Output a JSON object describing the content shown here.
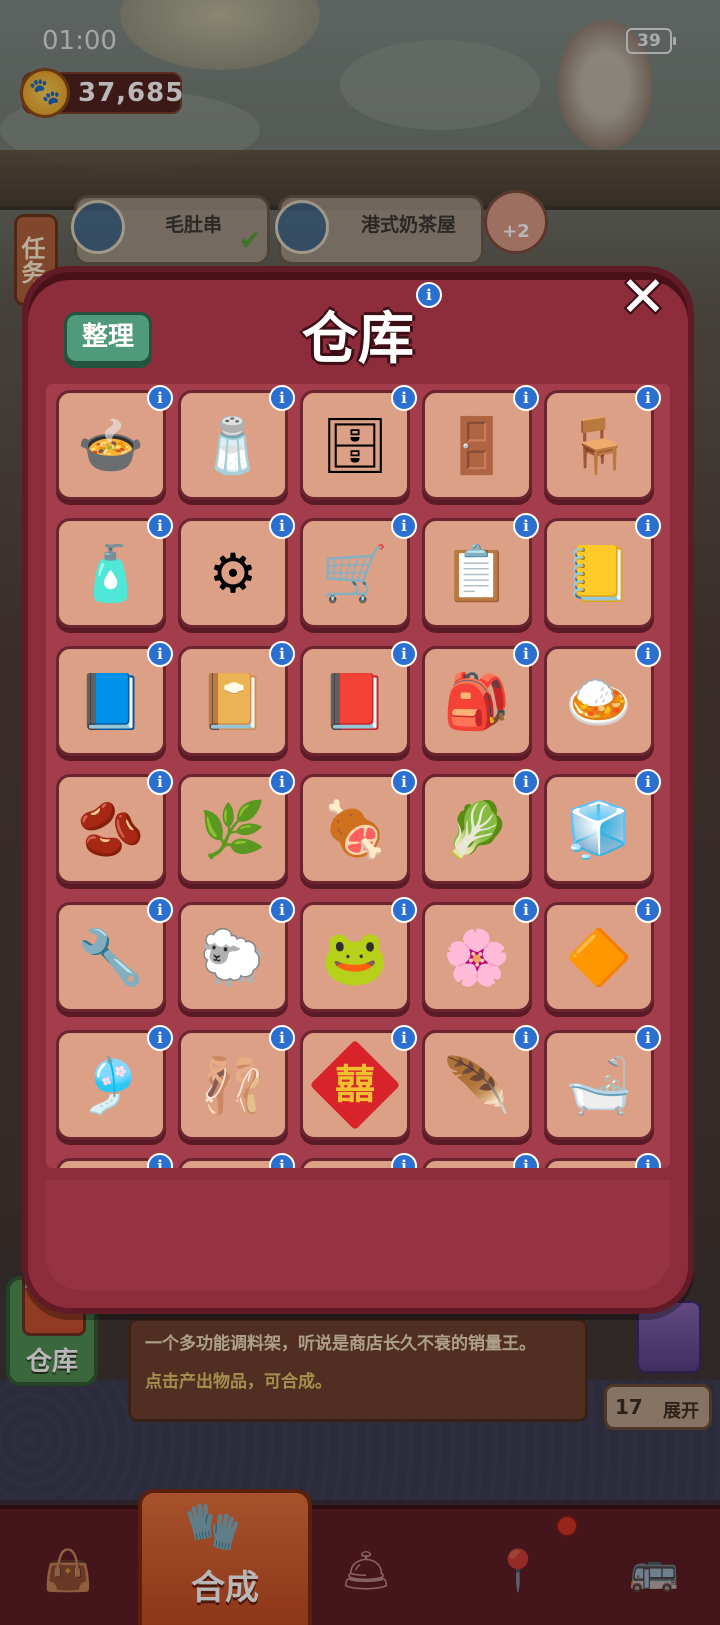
{
  "status": {
    "time": "01:00",
    "battery": "39"
  },
  "currency": {
    "amount": "37,685"
  },
  "task_tab": {
    "label": "任务"
  },
  "quests": [
    {
      "label": "毛肚串"
    },
    {
      "label": "港式奶茶屋"
    }
  ],
  "quest_bonus": "+2",
  "modal": {
    "title": "仓库",
    "sort_label": "整理",
    "close_icon": "close-icon",
    "info_icon": "i"
  },
  "items": [
    {
      "name": "clay-pot-icon",
      "glyph": "🍲"
    },
    {
      "name": "spice-rack-icon",
      "glyph": "🧂"
    },
    {
      "name": "blue-cabinet-icon",
      "glyph": "🗄"
    },
    {
      "name": "locker-icon",
      "glyph": "🚪"
    },
    {
      "name": "wall-shelf-icon",
      "glyph": "🪑"
    },
    {
      "name": "bottle-shelf-icon",
      "glyph": "🧴"
    },
    {
      "name": "tire-icon",
      "glyph": "⚙"
    },
    {
      "name": "hand-truck-icon",
      "glyph": "🛒"
    },
    {
      "name": "notepad-icon",
      "glyph": "📋"
    },
    {
      "name": "spiral-notebook-icon",
      "glyph": "📒"
    },
    {
      "name": "blue-notebook-icon",
      "glyph": "📘"
    },
    {
      "name": "bear-notebook-icon",
      "glyph": "📔"
    },
    {
      "name": "star-book-icon",
      "glyph": "📕"
    },
    {
      "name": "sack-icon",
      "glyph": "🎒"
    },
    {
      "name": "plate-dish-icon",
      "glyph": "🍛"
    },
    {
      "name": "beans-icon",
      "glyph": "🫘"
    },
    {
      "name": "herbs-board-icon",
      "glyph": "🌿"
    },
    {
      "name": "minced-meat-icon",
      "glyph": "🍖"
    },
    {
      "name": "greens-board-icon",
      "glyph": "🥬"
    },
    {
      "name": "salt-pile-icon",
      "glyph": "🧊"
    },
    {
      "name": "wrench-icon",
      "glyph": "🔧"
    },
    {
      "name": "sheep-icon",
      "glyph": "🐑"
    },
    {
      "name": "jade-cat-icon",
      "glyph": "🐸"
    },
    {
      "name": "flower-wreath-icon",
      "glyph": "🌸"
    },
    {
      "name": "amber-icon",
      "glyph": "🔶"
    },
    {
      "name": "wind-chime-icon",
      "glyph": "🎐"
    },
    {
      "name": "music-box-icon",
      "glyph": "🩰"
    },
    {
      "name": "double-happiness-icon",
      "glyph": "囍"
    },
    {
      "name": "dreamcatcher-icon",
      "glyph": "🪶"
    },
    {
      "name": "sink-icon",
      "glyph": "🛁"
    },
    {
      "name": "partial-item-icon",
      "glyph": ""
    },
    {
      "name": "partial-item-icon",
      "glyph": ""
    },
    {
      "name": "partial-item-icon",
      "glyph": ""
    },
    {
      "name": "partial-item-icon",
      "glyph": ""
    },
    {
      "name": "partial-item-icon",
      "glyph": ""
    }
  ],
  "warehouse": {
    "label": "仓库"
  },
  "description": {
    "text": "一个多功能调料架，听说是商店长久不衰的销量王。",
    "hint": "点击产出物品，可合成。"
  },
  "expand": {
    "count": "17",
    "label": "展开"
  },
  "nav": {
    "merge_label": "合成",
    "items": [
      "bag-icon",
      "merge-icon",
      "service-bell-icon",
      "map-icon",
      "bus-icon"
    ]
  },
  "colors": {
    "modal": "#8d2d3b",
    "cell": "#dca087",
    "info": "#2b6fd1",
    "sort_button": "#4f9a7a"
  }
}
